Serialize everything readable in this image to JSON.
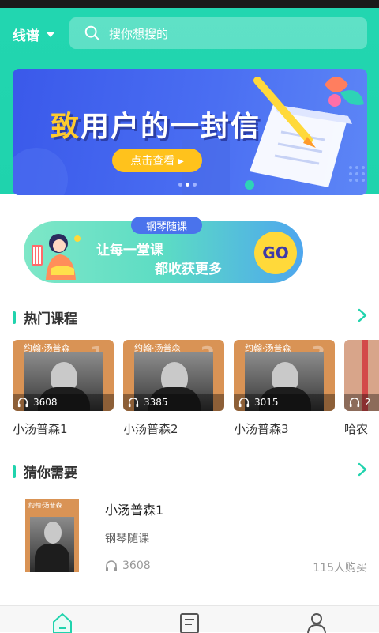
{
  "header": {
    "city": "线谱",
    "search_placeholder": "搜你想搜的"
  },
  "banner": {
    "title_first": "致",
    "title_rest": "用户的一封信",
    "button": "点击查看 ▸",
    "dots": 3,
    "active_dot": 0
  },
  "promo": {
    "tag": "钢琴随课",
    "line1": "让每一堂课",
    "line2": "都收获更多",
    "go": "GO"
  },
  "hot_courses": {
    "title": "热门课程",
    "items": [
      {
        "cover_title": "约翰·汤普森",
        "cover_num": "1",
        "plays": "3608",
        "name": "小汤普森1"
      },
      {
        "cover_title": "约翰·汤普森",
        "cover_num": "2",
        "plays": "3385",
        "name": "小汤普森2"
      },
      {
        "cover_title": "约翰·汤普森",
        "cover_num": "3",
        "plays": "3015",
        "name": "小汤普森3"
      },
      {
        "cover_title": "",
        "cover_num": "",
        "plays": "2",
        "name": "哈农"
      }
    ]
  },
  "recommend": {
    "title": "猜你需要",
    "items": [
      {
        "cover_title": "约翰·汤普森",
        "title": "小汤普森1",
        "subtitle": "钢琴随课",
        "plays": "3608",
        "buyers": "115人购买"
      }
    ]
  },
  "tabbar": {
    "items": [
      {
        "icon": "home-icon",
        "active": true
      },
      {
        "icon": "book-icon",
        "active": false
      },
      {
        "icon": "user-icon",
        "active": false
      }
    ]
  },
  "colors": {
    "accent": "#20d3ad",
    "banner": "#3a59ea",
    "button_yellow": "#ffc21c"
  }
}
